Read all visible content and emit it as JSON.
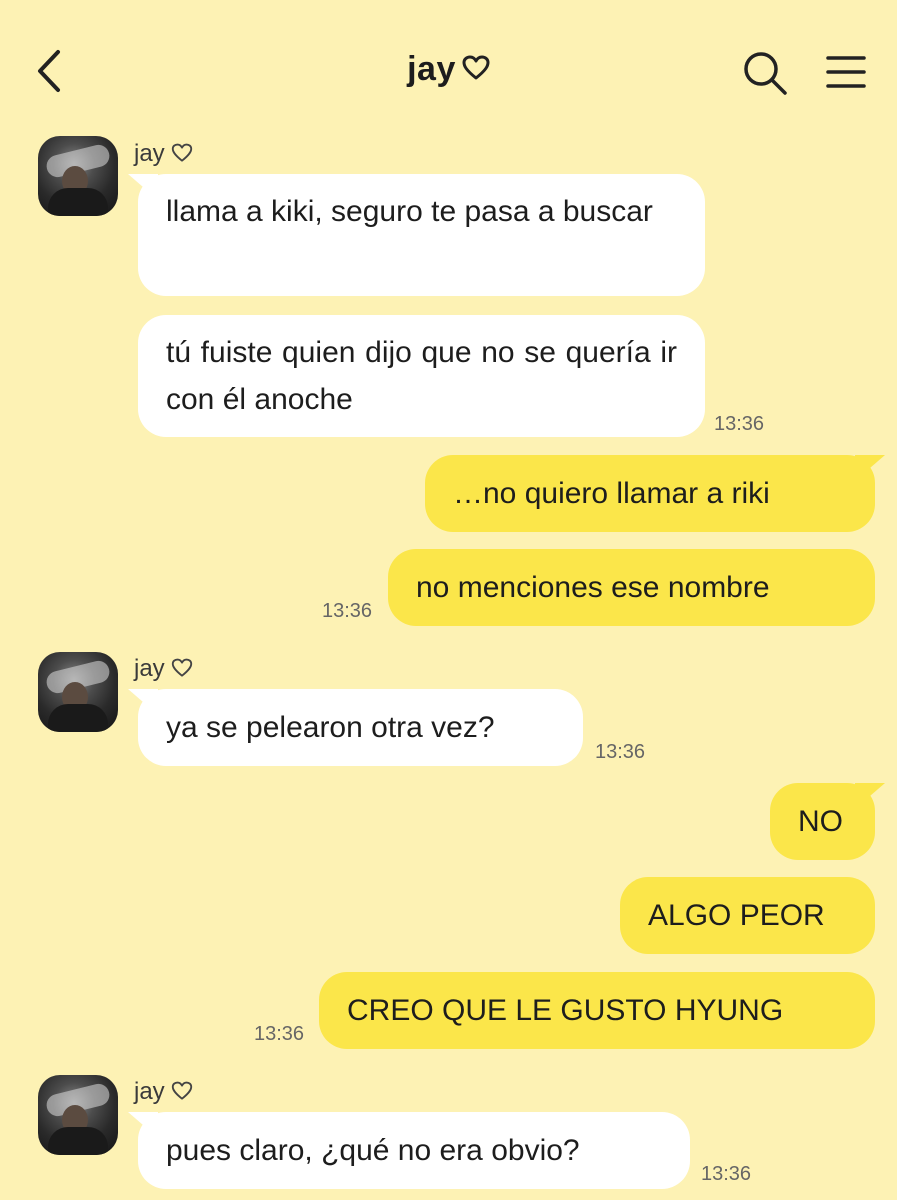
{
  "header": {
    "title": "jay",
    "back_icon": "chevron-left-icon",
    "search_icon": "search-icon",
    "menu_icon": "menu-icon",
    "heart_icon": "heart-outline-icon"
  },
  "colors": {
    "background": "#fdf2b4",
    "incoming_bubble": "#ffffff",
    "outgoing_bubble": "#fbe64a"
  },
  "messages": [
    {
      "sender": "jay",
      "text": "llama a kiki, seguro te pasa a buscar",
      "direction": "incoming"
    },
    {
      "sender": "jay",
      "text": "tú fuiste quien dijo que no se quería ir con él anoche",
      "direction": "incoming",
      "time": "13:36"
    },
    {
      "text": "…no quiero llamar a riki",
      "direction": "outgoing"
    },
    {
      "text": "no menciones ese nombre",
      "direction": "outgoing",
      "time": "13:36"
    },
    {
      "sender": "jay",
      "text": "ya se pelearon otra vez?",
      "direction": "incoming",
      "time": "13:36"
    },
    {
      "text": "NO",
      "direction": "outgoing"
    },
    {
      "text": "ALGO PEOR",
      "direction": "outgoing"
    },
    {
      "text": "CREO QUE LE GUSTO HYUNG",
      "direction": "outgoing",
      "time": "13:36"
    },
    {
      "sender": "jay",
      "text": "pues claro, ¿qué no era obvio?",
      "direction": "incoming",
      "time": "13:36"
    }
  ]
}
